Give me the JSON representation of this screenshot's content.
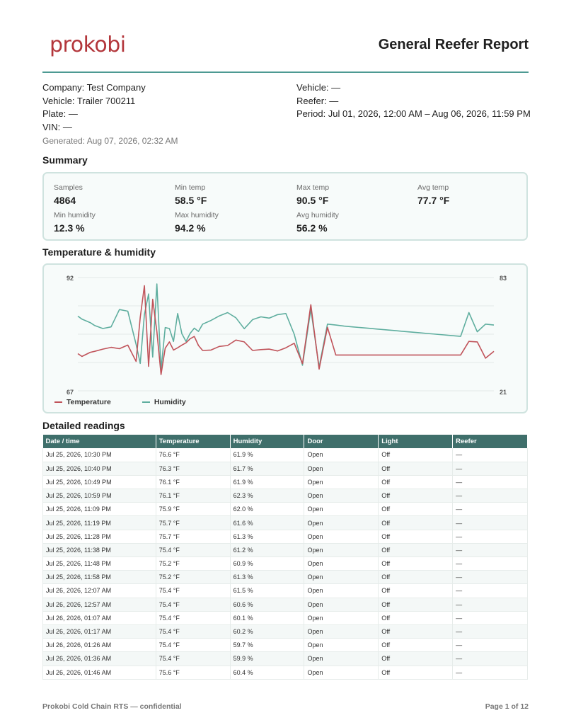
{
  "header": {
    "logo_text": "prokobi",
    "title": "General Reefer Report"
  },
  "info": {
    "company": "Company: Test Company",
    "vehicle_left": "Vehicle: Trailer 700211",
    "plate": "Plate: —",
    "vin": "VIN: —",
    "generated": "Generated: Aug 07, 2026, 02:32 AM",
    "vehicle_right": "Vehicle: —",
    "reefer": "Reefer: —",
    "period": "Period: Jul 01, 2026, 12:00 AM – Aug 06, 2026, 11:59 PM"
  },
  "summary": {
    "title": "Summary",
    "items": [
      {
        "label": "Samples",
        "value": "4864"
      },
      {
        "label": "Min temp",
        "value": "58.5 °F"
      },
      {
        "label": "Max temp",
        "value": "90.5 °F"
      },
      {
        "label": "Avg temp",
        "value": "77.7 °F"
      },
      {
        "label": "Min humidity",
        "value": "12.3 %"
      },
      {
        "label": "Max humidity",
        "value": "94.2 %"
      },
      {
        "label": "Avg humidity",
        "value": "56.2 %"
      }
    ]
  },
  "chart_section_title": "Temperature & humidity",
  "chart_data": {
    "type": "line",
    "title": "",
    "xlabel": "",
    "ylabel": "",
    "grid": true,
    "legend_position": "bottom-left",
    "y_left_ticks": [
      "92",
      "67"
    ],
    "y_right_ticks": [
      "83",
      "21"
    ],
    "y_left_range": [
      67,
      92
    ],
    "y_right_range": [
      21,
      83
    ],
    "x": [
      0,
      1,
      3,
      4,
      6,
      8,
      10,
      12,
      14,
      15,
      16,
      17,
      18,
      19,
      20,
      21,
      22,
      23,
      24,
      25,
      26,
      27,
      28,
      29,
      30,
      32,
      34,
      36,
      38,
      40,
      42,
      44,
      46,
      48,
      50,
      52,
      54,
      56,
      58,
      60,
      62,
      64,
      66,
      68,
      70,
      72,
      74,
      76,
      78,
      80,
      82,
      84,
      86,
      88,
      90,
      92,
      94,
      96,
      98,
      100
    ],
    "series": [
      {
        "name": "Temperature",
        "color": "#c0535a",
        "axis": "left",
        "values": [
          75.2,
          74.6,
          75.5,
          75.7,
          76.2,
          76.6,
          76.3,
          77.1,
          73.5,
          83.2,
          90.2,
          72.4,
          87.2,
          80.1,
          70.6,
          76.4,
          77.8,
          76.0,
          76.5,
          77.1,
          77.6,
          78.5,
          79.0,
          77.0,
          75.9,
          76.0,
          76.8,
          77.0,
          78.2,
          77.8,
          75.9,
          76.1,
          76.2,
          75.8,
          76.5,
          77.5,
          73.0,
          86.0,
          71.8,
          81.0,
          74.9,
          74.9,
          74.9,
          74.9,
          74.9,
          74.9,
          74.9,
          74.9,
          74.9,
          74.9,
          74.9,
          74.9,
          74.9,
          74.9,
          74.9,
          74.9,
          77.9,
          77.8,
          74.2,
          75.7
        ]
      },
      {
        "name": "Humidity",
        "color": "#5fae9f",
        "axis": "right",
        "values": [
          61.9,
          60.2,
          58.3,
          56.8,
          55.1,
          56.0,
          65.5,
          64.6,
          46.5,
          36.0,
          62.8,
          74.0,
          39.5,
          79.5,
          32.6,
          55.6,
          55.1,
          48.0,
          63.3,
          52.3,
          48.0,
          52.5,
          55.3,
          53.5,
          57.5,
          59.5,
          62.0,
          63.8,
          61.0,
          55.0,
          60.0,
          61.5,
          60.8,
          62.7,
          63.3,
          52.0,
          35.0,
          65.6,
          34.0,
          57.5,
          57.0,
          56.4,
          56.0,
          55.6,
          55.2,
          54.8,
          54.4,
          54.0,
          53.6,
          53.2,
          52.8,
          52.4,
          52.0,
          51.6,
          51.2,
          50.8,
          63.8,
          53.3,
          57.5,
          57.0
        ]
      }
    ]
  },
  "table_section_title": "Detailed readings",
  "table": {
    "headers": [
      "Date / time",
      "Temperature",
      "Humidity",
      "Door",
      "Light",
      "Reefer"
    ],
    "rows": [
      [
        "Jul 25, 2026, 10:30 PM",
        "76.6 °F",
        "61.9 %",
        "Open",
        "Off",
        "—"
      ],
      [
        "Jul 25, 2026, 10:40 PM",
        "76.3 °F",
        "61.7 %",
        "Open",
        "Off",
        "—"
      ],
      [
        "Jul 25, 2026, 10:49 PM",
        "76.1 °F",
        "61.9 %",
        "Open",
        "Off",
        "—"
      ],
      [
        "Jul 25, 2026, 10:59 PM",
        "76.1 °F",
        "62.3 %",
        "Open",
        "Off",
        "—"
      ],
      [
        "Jul 25, 2026, 11:09 PM",
        "75.9 °F",
        "62.0 %",
        "Open",
        "Off",
        "—"
      ],
      [
        "Jul 25, 2026, 11:19 PM",
        "75.7 °F",
        "61.6 %",
        "Open",
        "Off",
        "—"
      ],
      [
        "Jul 25, 2026, 11:28 PM",
        "75.7 °F",
        "61.3 %",
        "Open",
        "Off",
        "—"
      ],
      [
        "Jul 25, 2026, 11:38 PM",
        "75.4 °F",
        "61.2 %",
        "Open",
        "Off",
        "—"
      ],
      [
        "Jul 25, 2026, 11:48 PM",
        "75.2 °F",
        "60.9 %",
        "Open",
        "Off",
        "—"
      ],
      [
        "Jul 25, 2026, 11:58 PM",
        "75.2 °F",
        "61.3 %",
        "Open",
        "Off",
        "—"
      ],
      [
        "Jul 26, 2026, 12:07 AM",
        "75.4 °F",
        "61.5 %",
        "Open",
        "Off",
        "—"
      ],
      [
        "Jul 26, 2026, 12:57 AM",
        "75.4 °F",
        "60.6 %",
        "Open",
        "Off",
        "—"
      ],
      [
        "Jul 26, 2026, 01:07 AM",
        "75.4 °F",
        "60.1 %",
        "Open",
        "Off",
        "—"
      ],
      [
        "Jul 26, 2026, 01:17 AM",
        "75.4 °F",
        "60.2 %",
        "Open",
        "Off",
        "—"
      ],
      [
        "Jul 26, 2026, 01:26 AM",
        "75.4 °F",
        "59.7 %",
        "Open",
        "Off",
        "—"
      ],
      [
        "Jul 26, 2026, 01:36 AM",
        "75.4 °F",
        "59.9 %",
        "Open",
        "Off",
        "—"
      ],
      [
        "Jul 26, 2026, 01:46 AM",
        "75.6 °F",
        "60.4 %",
        "Open",
        "Off",
        "—"
      ]
    ]
  },
  "footer": {
    "left": "Prokobi Cold Chain RTS — confidential",
    "right": "Page 1 of 12"
  }
}
